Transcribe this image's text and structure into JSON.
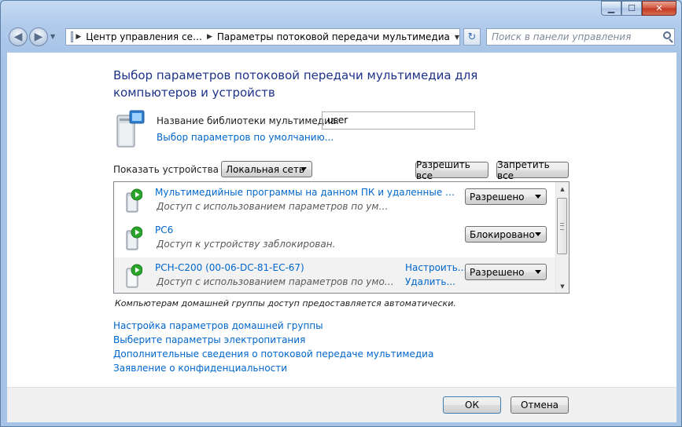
{
  "window": {
    "caption_buttons": [
      "minimize",
      "maximize",
      "close"
    ]
  },
  "nav": {
    "address_segments": [
      "Центр управления се…",
      "Параметры потоковой передачи мультимедиа"
    ],
    "search_placeholder": "Поиск в панели управления"
  },
  "main": {
    "title": "Выбор параметров потоковой передачи мультимедиа для компьютеров и устройств",
    "library_label": "Название библиотеки мультимедиа:",
    "library_value": "user",
    "default_link": "Выбор параметров по умолчанию...",
    "show_devices_label": "Показать устройства на:",
    "network_selected": "Локальная сеть",
    "allow_all": "Разрешить все",
    "deny_all": "Запретить все",
    "devices": [
      {
        "name": "Мультимедийные программы на данном ПК и удаленные подключения",
        "status": "Доступ с использованием параметров по умолчанию разрешен.",
        "access": "Разрешено",
        "configure": "",
        "remove": ""
      },
      {
        "name": "PC6",
        "status": "Доступ к устройству заблокирован.",
        "access": "Блокировано",
        "configure": "",
        "remove": ""
      },
      {
        "name": "PCH-C200 (00-06-DC-81-EC-67)",
        "status": "Доступ с использованием параметров по умолчанию разрешен.",
        "access": "Разрешено",
        "configure": "Настроить...",
        "remove": "Удалить..."
      }
    ],
    "homegroup_note": "Компьютерам домашней группы доступ предоставляется автоматически.",
    "links": [
      "Настройка параметров домашней группы",
      "Выберите параметры электропитания",
      "Дополнительные сведения о потоковой передаче мультимедиа",
      "Заявление о конфиденциальности"
    ]
  },
  "footer": {
    "ok": "ОК",
    "cancel": "Отмена"
  },
  "icons": [
    "back-icon",
    "forward-icon",
    "control-panel-icon",
    "refresh-icon",
    "search-icon",
    "media-library-icon",
    "device-icon",
    "play-icon"
  ],
  "colors": {
    "link": "#0066cc",
    "title": "#1e3287",
    "frame": "#a9c6e8"
  }
}
